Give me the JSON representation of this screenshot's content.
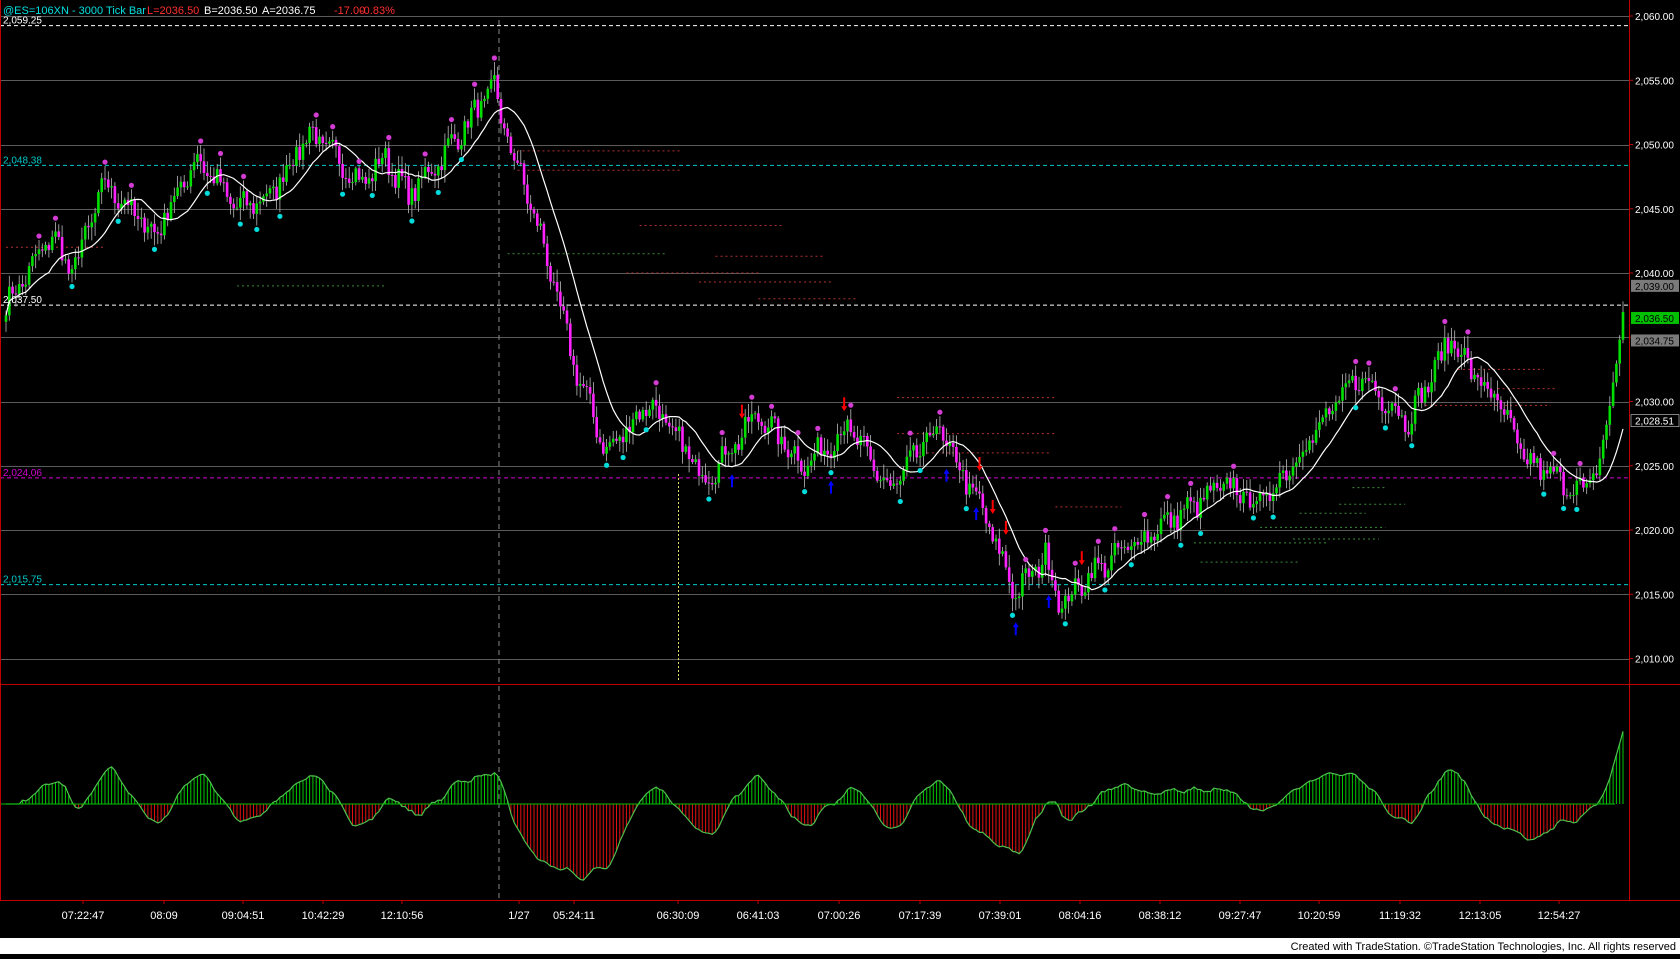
{
  "header": {
    "symbol_label": "@ES=106XN - 3000 Tick Bar",
    "last_label": "L=2036.50",
    "bid_label": "B=2036.50",
    "ask_label": "A=2036.75",
    "change_label": "-17.00",
    "change_pct_label": "-0.83%"
  },
  "footer": {
    "credit": "Created with TradeStation. ©TradeStation Technologies, Inc. All rights reserved"
  },
  "colors": {
    "background": "#000000",
    "up_bar": "#00e000",
    "down_bar": "#ff22ff",
    "grid": "#7a7a7a",
    "ma_line": "#ffffff",
    "osc_positive": "#00c800",
    "osc_negative": "#e01010",
    "hline_cyan": "#00c8c8",
    "hline_magenta": "#d200d2",
    "current_price_box": "#00c000",
    "swing_high_dot": "#d23cd2",
    "swing_low_dot": "#00dcdc",
    "buy_arrow": "#0000ff",
    "sell_arrow": "#ff0000"
  },
  "chart_data": {
    "type": "candlestick",
    "price_axis": {
      "ylim": [
        2008.4,
        2060.6
      ],
      "ticks": [
        2010,
        2015,
        2020,
        2025,
        2030,
        2035,
        2040,
        2045,
        2050,
        2055,
        2060
      ],
      "tick_labels": [
        "2,010.00",
        "2,015.00",
        "2,020.00",
        "2,025.00",
        "2,030.00",
        "2,035.00",
        "2,040.00",
        "2,045.00",
        "2,050.00",
        "2,055.00",
        "2,060.00"
      ]
    },
    "time_labels": [
      "07:22:47",
      "08:09",
      "09:04:51",
      "10:42:29",
      "12:10:56",
      "1/27",
      "05:24:11",
      "06:30:09",
      "06:41:03",
      "07:00:26",
      "07:17:39",
      "07:39:01",
      "08:04:16",
      "08:38:12",
      "09:27:47",
      "10:20:59",
      "11:19:32",
      "12:13:05",
      "12:54:27"
    ],
    "level_lines": [
      {
        "value": 2059.25,
        "label": "2,059.25",
        "color": "#ffffff"
      },
      {
        "value": 2048.38,
        "label": "2,048.38",
        "color": "#00c8c8"
      },
      {
        "value": 2037.5,
        "label": "2,037.50",
        "color": "#ffffff"
      },
      {
        "value": 2024.06,
        "label": "2,024.06",
        "color": "#d200d2"
      },
      {
        "value": 2015.75,
        "label": "2,015.75",
        "color": "#00c8c8"
      }
    ],
    "price_markers": [
      {
        "value": 2039.0,
        "label": "2,039.00",
        "kind": "bid"
      },
      {
        "value": 2036.5,
        "label": "2,036.50",
        "kind": "last"
      },
      {
        "value": 2034.75,
        "label": "2,034.75",
        "kind": "ask"
      },
      {
        "value": 2028.51,
        "label": "2,028.51",
        "kind": "ma"
      }
    ],
    "anchors": [
      [
        0,
        2037.5
      ],
      [
        8,
        2040.5
      ],
      [
        14,
        2043
      ],
      [
        20,
        2040
      ],
      [
        30,
        2047
      ],
      [
        45,
        2043
      ],
      [
        58,
        2049
      ],
      [
        70,
        2045
      ],
      [
        80,
        2046
      ],
      [
        92,
        2051
      ],
      [
        108,
        2047
      ],
      [
        115,
        2049
      ],
      [
        122,
        2046
      ],
      [
        132,
        2049
      ],
      [
        148,
        2054.5
      ],
      [
        150,
        2052
      ],
      [
        162,
        2043
      ],
      [
        172,
        2033
      ],
      [
        182,
        2026
      ],
      [
        195,
        2030
      ],
      [
        212,
        2024
      ],
      [
        228,
        2029
      ],
      [
        242,
        2025
      ],
      [
        255,
        2028
      ],
      [
        268,
        2023
      ],
      [
        282,
        2028
      ],
      [
        295,
        2022
      ],
      [
        306,
        2015
      ],
      [
        315,
        2018
      ],
      [
        320,
        2014
      ],
      [
        328,
        2016.5
      ],
      [
        348,
        2020
      ],
      [
        370,
        2023.5
      ],
      [
        380,
        2022
      ],
      [
        395,
        2027
      ],
      [
        410,
        2032
      ],
      [
        425,
        2028.5
      ],
      [
        438,
        2035
      ],
      [
        445,
        2032
      ],
      [
        452,
        2030
      ],
      [
        460,
        2025.5
      ],
      [
        470,
        2024
      ],
      [
        478,
        2023
      ],
      [
        483,
        2025
      ],
      [
        490,
        2036.5
      ]
    ],
    "oscillator": {
      "zero_line": true,
      "range": [
        -1,
        1
      ]
    }
  }
}
